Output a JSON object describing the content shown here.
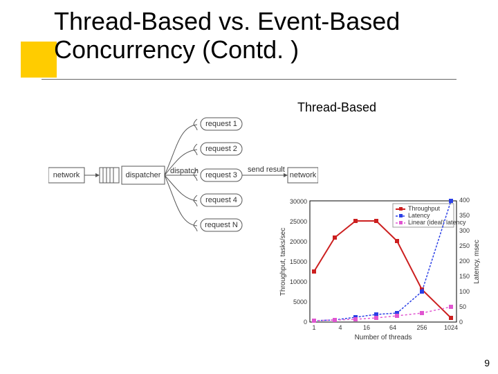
{
  "title": "Thread-Based vs. Event-Based Concurrency (Contd. )",
  "caption_thread": "Thread-Based",
  "page_number": "9",
  "diagram": {
    "network_in": "network",
    "dispatcher": "dispatcher",
    "dispatch_label": "dispatch",
    "send_result": "send result",
    "network_out": "network",
    "requests": [
      "request 1",
      "request 2",
      "request 3",
      "request 4",
      "request N"
    ]
  },
  "chart_data": {
    "type": "line",
    "title": "",
    "xlabel": "Number of threads",
    "ylabel_left": "Throughput, tasks/sec",
    "ylabel_right": "Latency, msec",
    "x_categories": [
      "1",
      "4",
      "16",
      "64",
      "256",
      "1024"
    ],
    "left_ticks": [
      0,
      5000,
      10000,
      15000,
      20000,
      25000,
      30000
    ],
    "right_ticks": [
      0,
      50,
      100,
      150,
      200,
      250,
      300,
      350,
      400
    ],
    "legend": [
      "Throughput",
      "Latency",
      "Linear (ideal) latency"
    ],
    "series": [
      {
        "name": "Throughput",
        "axis": "left",
        "values": [
          12500,
          21000,
          25000,
          25000,
          20000,
          8000,
          1000
        ]
      },
      {
        "name": "Latency",
        "axis": "right",
        "values": [
          5,
          8,
          15,
          25,
          30,
          100,
          400
        ]
      },
      {
        "name": "Linear (ideal) latency",
        "axis": "right",
        "values": [
          4,
          6,
          9,
          13,
          20,
          30,
          50
        ]
      }
    ],
    "x_positions_note": "7 plotted x-points roughly at 1,4,16,64,128,256,1024 on log axis"
  }
}
